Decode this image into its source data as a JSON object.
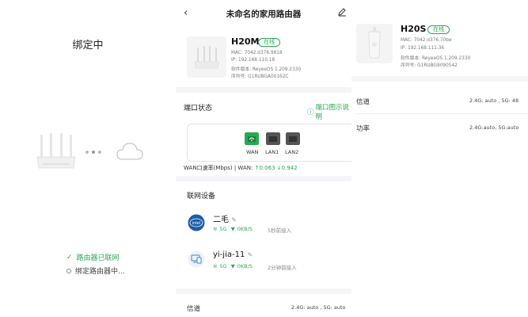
{
  "panel1": {
    "title": "绑定中",
    "steps": [
      {
        "label": "路由器已联网",
        "status": "done"
      },
      {
        "label": "绑定路由器中...",
        "status": "pending"
      }
    ]
  },
  "panel2": {
    "nav_title": "未命名的家用路由器",
    "device": {
      "name": "H20M",
      "badge": "在线",
      "mac": "MAC:  7042.d376.9818",
      "ip": "IP:  192.168.110.18",
      "firmware": "软件版本:  ReyeeOS 1.209.2330",
      "serial": "序列号:  G1RUBGA00162C"
    },
    "port_section": {
      "title": "端口状态",
      "help": "端口图示说明",
      "ports": [
        "WAN",
        "LAN1",
        "LAN2"
      ],
      "rate_label": "WAN口速率(Mbps) | WAN:",
      "rate_up": "↑0.063",
      "rate_down": "↓0.942"
    },
    "clients_section": {
      "title": "联网设备",
      "clients": [
        {
          "name": "二毛",
          "band": "5G",
          "speed": "0KB/S",
          "time": "5秒前接入",
          "icon": "intel-icon"
        },
        {
          "name": "yi-jia-11",
          "band": "5G",
          "speed": "0KB/S",
          "time": "2分钟前接入",
          "icon": "pc-icon"
        }
      ]
    },
    "channel_row": {
      "label": "信道",
      "value": "2.4G: auto , 5G: auto"
    }
  },
  "panel3": {
    "device": {
      "name": "H20S",
      "badge": "在线",
      "mac": "MAC:  7042.d376.70be",
      "ip": "IP:  192.168.111.36",
      "firmware": "软件版本:  ReyeeOS 1.209.2330",
      "serial": "序列号:  G1RUBG9090542"
    },
    "rows": [
      {
        "label": "信道",
        "value": "2.4G: auto , 5G: 48"
      },
      {
        "label": "功率",
        "value": "2.4G:auto, 5G:auto"
      }
    ]
  },
  "colors": {
    "accent": "#2aa852",
    "port_active": "#2aa852",
    "port_inactive": "#555555",
    "separator": "#f4f5f7"
  }
}
